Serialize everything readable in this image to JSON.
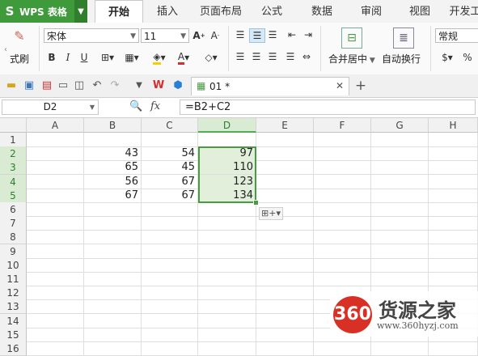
{
  "app": {
    "name": "WPS 表格"
  },
  "tabs": [
    "开始",
    "插入",
    "页面布局",
    "公式",
    "数据",
    "审阅",
    "视图",
    "开发工"
  ],
  "ribbon": {
    "format_painter": "式刷",
    "font_name": "宋体",
    "font_size": "11",
    "merge_center": "合并居中",
    "wrap_text": "自动换行",
    "number_format": "常规"
  },
  "doc_tab": {
    "label": "01 *"
  },
  "formula_bar": {
    "cell_ref": "D2",
    "fx": "fx",
    "formula": "=B2+C2"
  },
  "grid": {
    "columns": [
      "A",
      "B",
      "C",
      "D",
      "E",
      "F",
      "G",
      "H"
    ],
    "rows": [
      "1",
      "2",
      "3",
      "4",
      "5",
      "6",
      "7",
      "8",
      "9",
      "10",
      "11",
      "12",
      "13",
      "14",
      "15",
      "16"
    ],
    "data": [
      {
        "row": "2",
        "B": "43",
        "C": "54",
        "D": "97"
      },
      {
        "row": "3",
        "B": "65",
        "C": "45",
        "D": "110"
      },
      {
        "row": "4",
        "B": "56",
        "C": "67",
        "D": "123"
      },
      {
        "row": "5",
        "B": "67",
        "C": "67",
        "D": "134"
      }
    ]
  },
  "watermark": {
    "logo": "360",
    "title": "货源之家",
    "url": "www.360hyzj.com"
  },
  "colors": {
    "brand_green": "#3f9a3c",
    "selection_green": "#4a9a44",
    "watermark_red": "#d93025"
  }
}
